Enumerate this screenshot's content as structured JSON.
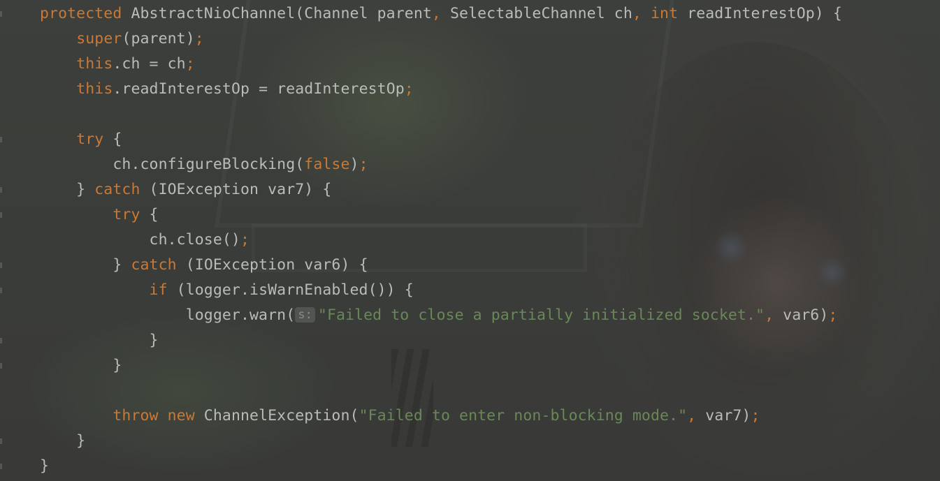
{
  "code_editor": {
    "language": "java",
    "lines": [
      [
        {
          "t": "protected",
          "k": "kw"
        },
        {
          "t": " AbstractNioChannel(Channel parent",
          "k": "id"
        },
        {
          "t": ",",
          "k": "semi"
        },
        {
          "t": " SelectableChannel ch",
          "k": "id"
        },
        {
          "t": ",",
          "k": "semi"
        },
        {
          "t": " ",
          "k": "id"
        },
        {
          "t": "int",
          "k": "kw"
        },
        {
          "t": " readInterestOp) {",
          "k": "id"
        }
      ],
      [
        {
          "t": "    ",
          "k": "id"
        },
        {
          "t": "super",
          "k": "kw"
        },
        {
          "t": "(parent)",
          "k": "id"
        },
        {
          "t": ";",
          "k": "semi"
        }
      ],
      [
        {
          "t": "    ",
          "k": "id"
        },
        {
          "t": "this",
          "k": "kw"
        },
        {
          "t": ".ch = ch",
          "k": "id"
        },
        {
          "t": ";",
          "k": "semi"
        }
      ],
      [
        {
          "t": "    ",
          "k": "id"
        },
        {
          "t": "this",
          "k": "kw"
        },
        {
          "t": ".readInterestOp = readInterestOp",
          "k": "id"
        },
        {
          "t": ";",
          "k": "semi"
        }
      ],
      [],
      [
        {
          "t": "    ",
          "k": "id"
        },
        {
          "t": "try",
          "k": "kw"
        },
        {
          "t": " {",
          "k": "id"
        }
      ],
      [
        {
          "t": "        ch.configureBlocking(",
          "k": "id"
        },
        {
          "t": "false",
          "k": "kw"
        },
        {
          "t": ")",
          "k": "id"
        },
        {
          "t": ";",
          "k": "semi"
        }
      ],
      [
        {
          "t": "    } ",
          "k": "id"
        },
        {
          "t": "catch",
          "k": "kw"
        },
        {
          "t": " (IOException var7) {",
          "k": "id"
        }
      ],
      [
        {
          "t": "        ",
          "k": "id"
        },
        {
          "t": "try",
          "k": "kw"
        },
        {
          "t": " {",
          "k": "id"
        }
      ],
      [
        {
          "t": "            ch.close()",
          "k": "id"
        },
        {
          "t": ";",
          "k": "semi"
        }
      ],
      [
        {
          "t": "        } ",
          "k": "id"
        },
        {
          "t": "catch",
          "k": "kw"
        },
        {
          "t": " (IOException var6) {",
          "k": "id"
        }
      ],
      [
        {
          "t": "            ",
          "k": "id"
        },
        {
          "t": "if",
          "k": "kw"
        },
        {
          "t": " (logger.isWarnEnabled()) {",
          "k": "id"
        }
      ],
      [
        {
          "t": "                logger.warn(",
          "k": "id"
        },
        {
          "t": "s:",
          "k": "hint"
        },
        {
          "t": "\"Failed to close a partially initialized socket.\"",
          "k": "str"
        },
        {
          "t": ",",
          "k": "semi"
        },
        {
          "t": " var6)",
          "k": "id"
        },
        {
          "t": ";",
          "k": "semi"
        }
      ],
      [
        {
          "t": "            }",
          "k": "id"
        }
      ],
      [
        {
          "t": "        }",
          "k": "id"
        }
      ],
      [],
      [
        {
          "t": "        ",
          "k": "id"
        },
        {
          "t": "throw new",
          "k": "kw"
        },
        {
          "t": " ChannelException(",
          "k": "id"
        },
        {
          "t": "\"Failed to enter non-blocking mode.\"",
          "k": "str"
        },
        {
          "t": ",",
          "k": "semi"
        },
        {
          "t": " var7)",
          "k": "id"
        },
        {
          "t": ";",
          "k": "semi"
        }
      ],
      [
        {
          "t": "    }",
          "k": "id"
        }
      ],
      [
        {
          "t": "}",
          "k": "id"
        }
      ]
    ]
  }
}
